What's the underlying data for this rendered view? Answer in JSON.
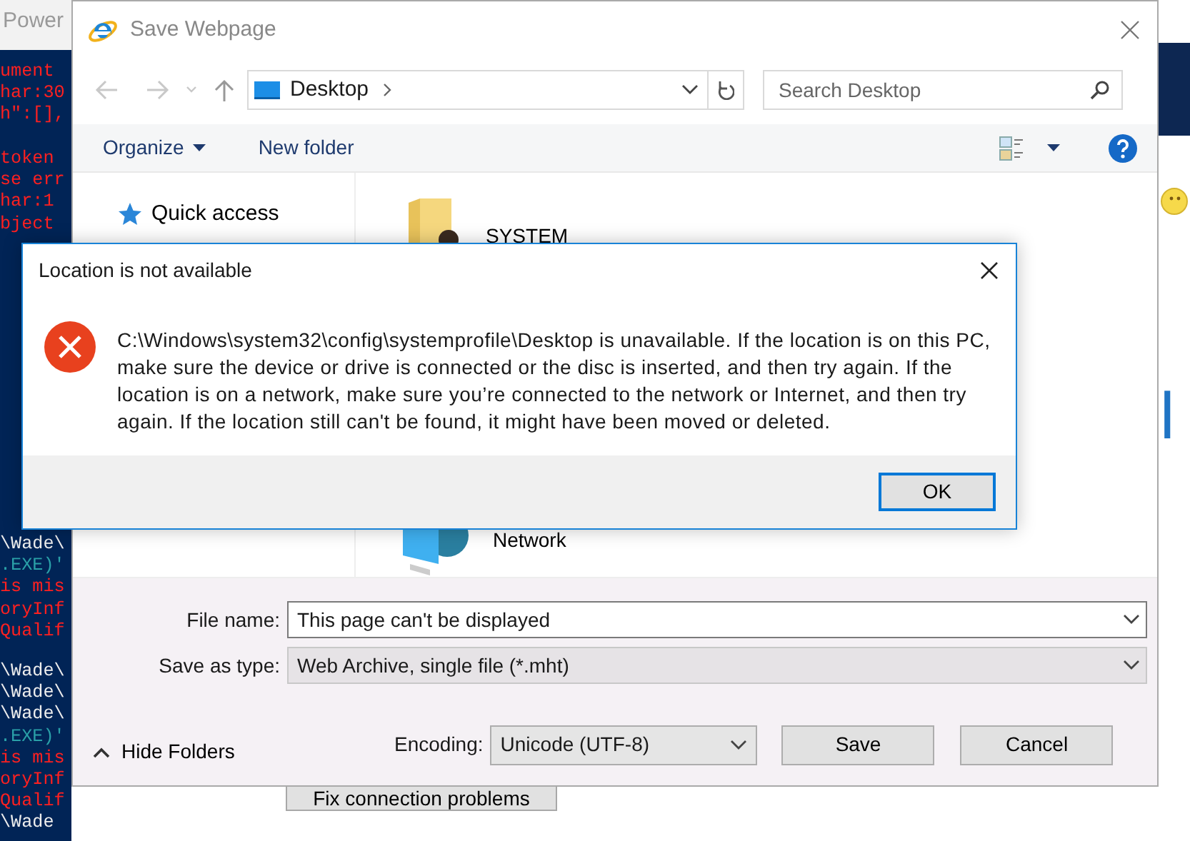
{
  "console_window": {
    "title": "Power",
    "line_groups": [
      {
        "lines": [
          {
            "text": "ument",
            "color": "#ff2020"
          },
          {
            "text": "har:30",
            "color": "#ff2020"
          },
          {
            "text": "h\":[],",
            "color": "#ff2020"
          }
        ]
      },
      {
        "lines": [
          {
            "text": "token",
            "color": "#ff2020"
          },
          {
            "text": "se err",
            "color": "#ff2020"
          },
          {
            "text": "har:1",
            "color": "#ff2020"
          },
          {
            "text": "bject",
            "color": "#ff2020"
          }
        ]
      },
      {
        "lines": [
          {
            "text": "\\Wade\\",
            "color": "#eeeeee"
          },
          {
            "text": ".EXE)'",
            "color": "#2aa0a8"
          },
          {
            "text": "is mis",
            "color": "#ff2020"
          },
          {
            "text": "oryInf",
            "color": "#ff2020"
          },
          {
            "text": "Qualif",
            "color": "#ff2020"
          }
        ]
      },
      {
        "lines": [
          {
            "text": "\\Wade\\",
            "color": "#eeeeee"
          },
          {
            "text": "\\Wade\\",
            "color": "#eeeeee"
          },
          {
            "text": "\\Wade\\",
            "color": "#eeeeee"
          },
          {
            "text": ".EXE)'",
            "color": "#2aa0a8"
          },
          {
            "text": "is mis",
            "color": "#ff2020"
          },
          {
            "text": "oryInf",
            "color": "#ff2020"
          },
          {
            "text": "Qualif",
            "color": "#ff2020"
          },
          {
            "text": "\\Wade",
            "color": "#eeeeee"
          }
        ]
      }
    ]
  },
  "browser_window": {
    "heading_fragment": "l",
    "button": "Fix connection problems"
  },
  "save_dialog": {
    "title": "Save Webpage",
    "address": {
      "location": "Desktop"
    },
    "search": {
      "placeholder": "Search Desktop"
    },
    "toolbar": {
      "organize": "Organize",
      "new_folder": "New folder"
    },
    "navigation": [
      {
        "label": "Quick access"
      }
    ],
    "items": [
      {
        "label": "SYSTEM",
        "kind": "user-folder"
      },
      {
        "label": "Network",
        "kind": "network"
      }
    ],
    "file_name": {
      "label": "File name:",
      "value": "This page can't be displayed"
    },
    "save_as_type": {
      "label": "Save as type:",
      "value": "Web Archive, single file (*.mht)",
      "disabled": true
    },
    "hide_folders": "Hide Folders",
    "encoding": {
      "label": "Encoding:",
      "value": "Unicode (UTF-8)"
    },
    "buttons": [
      "Save",
      "Cancel"
    ]
  },
  "error_dialog": {
    "title": "Location is not available",
    "message": "C:\\Windows\\system32\\config\\systemprofile\\Desktop is unavailable. If the location is on this PC, make sure the device or drive is connected or the disc is inserted, and then try again. If the location is on a network, make sure you’re connected to the network or Internet, and then try again. If the location still can't be found, it might have been moved or deleted.",
    "buttons": [
      "OK"
    ]
  }
}
